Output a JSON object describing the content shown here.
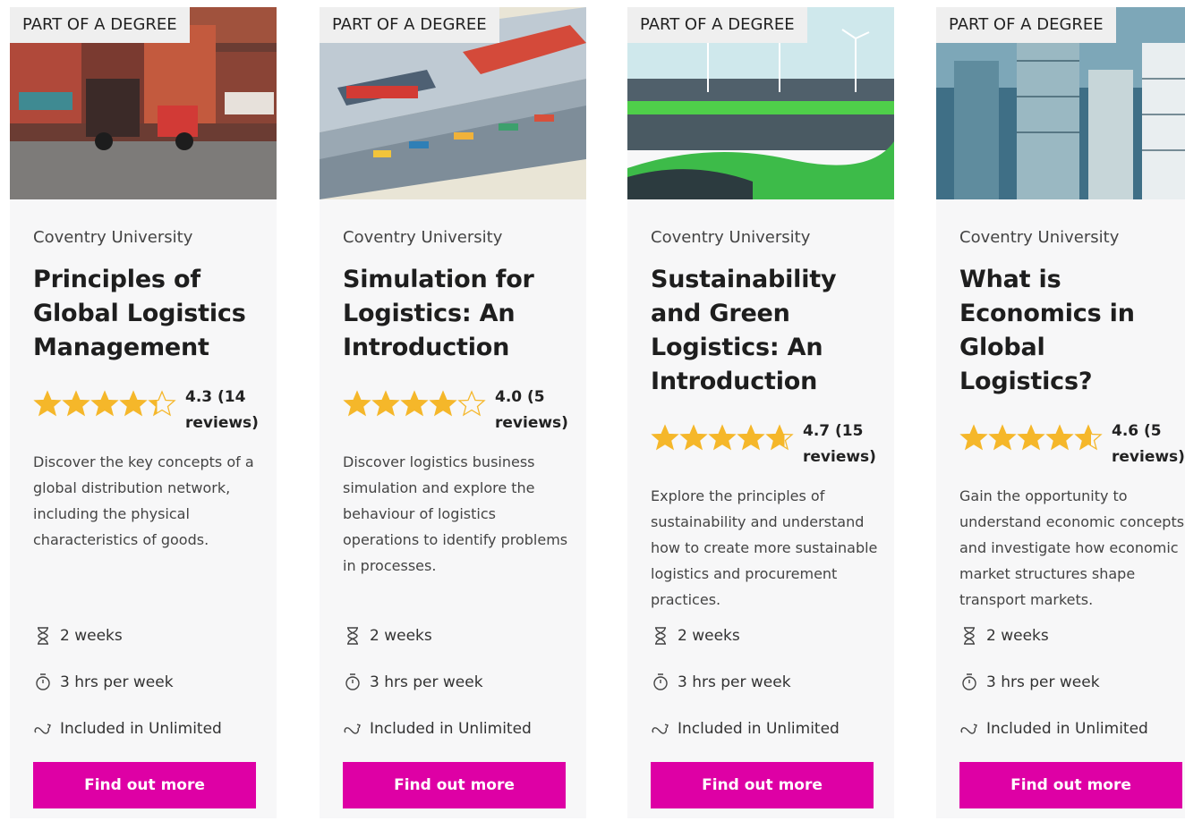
{
  "colors": {
    "accent": "#de00a5",
    "star": "#f5b72a",
    "card_bg": "#f7f7f8",
    "badge_bg": "#efefef"
  },
  "cards": [
    {
      "badge": "PART OF A DEGREE",
      "provider": "Coventry University",
      "title": "Principles of Global Logistics Management",
      "rating_value": 4.3,
      "rating_text": "4.3 (14 reviews)",
      "description": "Discover the key concepts of a global distribution network, including the physical characteristics of goods.",
      "duration": "2 weeks",
      "hours": "3 hrs per week",
      "unlimited": "Included in Unlimited",
      "cta": "Find out more"
    },
    {
      "badge": "PART OF A DEGREE",
      "provider": "Coventry University",
      "title": "Simulation for Logistics: An Introduction",
      "rating_value": 4.0,
      "rating_text": "4.0 (5 reviews)",
      "description": "Discover logistics business simulation and explore the behaviour of logistics operations to identify problems in processes.",
      "duration": "2 weeks",
      "hours": "3 hrs per week",
      "unlimited": "Included in Unlimited",
      "cta": "Find out more"
    },
    {
      "badge": "PART OF A DEGREE",
      "provider": "Coventry University",
      "title": "Sustainability and Green Logistics: An Introduction",
      "rating_value": 4.7,
      "rating_text": "4.7 (15 reviews)",
      "description": "Explore the principles of sustainability and understand how to create more sustainable logistics and procurement practices.",
      "duration": "2 weeks",
      "hours": "3 hrs per week",
      "unlimited": "Included in Unlimited",
      "cta": "Find out more"
    },
    {
      "badge": "PART OF A DEGREE",
      "provider": "Coventry University",
      "title": "What is Economics in Global Logistics?",
      "rating_value": 4.6,
      "rating_text": "4.6 (5 reviews)",
      "description": "Gain the opportunity to understand economic concepts and investigate how economic market structures shape transport markets.",
      "duration": "2 weeks",
      "hours": "3 hrs per week",
      "unlimited": "Included in Unlimited",
      "cta": "Find out more"
    }
  ]
}
